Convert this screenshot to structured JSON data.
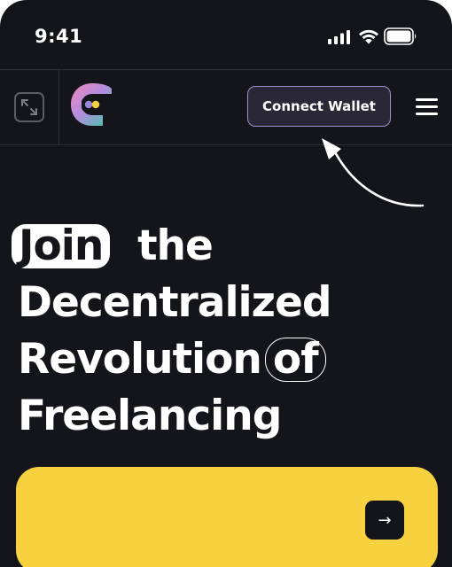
{
  "status_bar": {
    "time": "9:41"
  },
  "nav": {
    "connect_wallet_label": "Connect Wallet",
    "icons": [
      "expand-icon",
      "app-logo",
      "hamburger-menu-icon"
    ]
  },
  "hero": {
    "line1_highlight": "Join",
    "line1_rest": "the",
    "line2": "Decentralized",
    "line3_main": "Revolution",
    "line3_outline": "of",
    "line4": "Freelancing"
  },
  "cta_card": {
    "arrow_glyph": "→"
  },
  "colors": {
    "background": "#14151b",
    "accent_yellow": "#f7d23e",
    "button_border": "#9d8fd0",
    "button_fill": "#2a2837"
  }
}
